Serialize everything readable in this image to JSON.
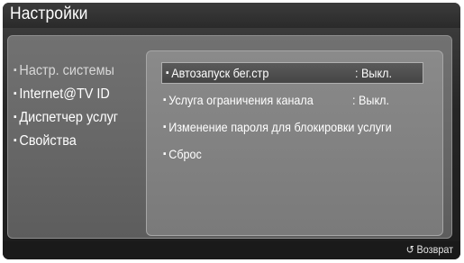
{
  "header": {
    "title": "Настройки"
  },
  "left_menu": {
    "items": [
      {
        "label": "Настр. системы",
        "active": true
      },
      {
        "label": "Internet@TV ID",
        "active": false
      },
      {
        "label": "Диспетчер услуг",
        "active": false
      },
      {
        "label": "Свойства",
        "active": false
      }
    ]
  },
  "options": [
    {
      "label": "Автозапуск бег.стр",
      "value": ": Выкл.",
      "selected": true
    },
    {
      "label": "Услуга ограничения канала",
      "value": ": Выкл.",
      "selected": false
    },
    {
      "label": "Изменение пароля для блокировки услуги",
      "value": "",
      "selected": false
    },
    {
      "label": "Сброс",
      "value": "",
      "selected": false
    }
  ],
  "footer": {
    "return_label": "Возврат",
    "return_icon": "return-arrow-icon"
  },
  "bullet": "▪"
}
